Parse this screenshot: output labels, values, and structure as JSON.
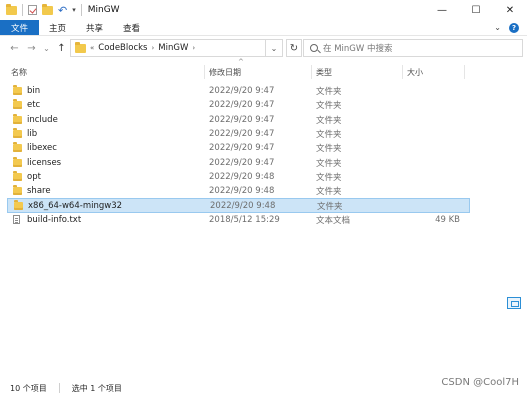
{
  "window": {
    "title": "MinGW",
    "controls": {
      "minimize": "—",
      "maximize": "☐",
      "close": "✕"
    }
  },
  "ribbon": {
    "tabs": [
      "文件",
      "主页",
      "共享",
      "查看"
    ],
    "expand": "⌄",
    "help": "?"
  },
  "nav": {
    "back": "←",
    "forward": "→",
    "recent": "⌄",
    "up": "↑"
  },
  "address": {
    "segments": [
      "CodeBlocks",
      "MinGW"
    ],
    "separator": "›",
    "lead_sep": "«",
    "dropdown": "⌄",
    "refresh": "↻"
  },
  "search": {
    "placeholder": "在 MinGW 中搜索"
  },
  "columns": {
    "name": "名称",
    "modified": "修改日期",
    "type": "类型",
    "size": "大小",
    "sort_indicator": "^"
  },
  "files": [
    {
      "name": "bin",
      "modified": "2022/9/20 9:47",
      "type": "文件夹",
      "size": "",
      "kind": "folder",
      "selected": false
    },
    {
      "name": "etc",
      "modified": "2022/9/20 9:47",
      "type": "文件夹",
      "size": "",
      "kind": "folder",
      "selected": false
    },
    {
      "name": "include",
      "modified": "2022/9/20 9:47",
      "type": "文件夹",
      "size": "",
      "kind": "folder",
      "selected": false
    },
    {
      "name": "lib",
      "modified": "2022/9/20 9:47",
      "type": "文件夹",
      "size": "",
      "kind": "folder",
      "selected": false
    },
    {
      "name": "libexec",
      "modified": "2022/9/20 9:47",
      "type": "文件夹",
      "size": "",
      "kind": "folder",
      "selected": false
    },
    {
      "name": "licenses",
      "modified": "2022/9/20 9:47",
      "type": "文件夹",
      "size": "",
      "kind": "folder",
      "selected": false
    },
    {
      "name": "opt",
      "modified": "2022/9/20 9:48",
      "type": "文件夹",
      "size": "",
      "kind": "folder",
      "selected": false
    },
    {
      "name": "share",
      "modified": "2022/9/20 9:48",
      "type": "文件夹",
      "size": "",
      "kind": "folder",
      "selected": false
    },
    {
      "name": "x86_64-w64-mingw32",
      "modified": "2022/9/20 9:48",
      "type": "文件夹",
      "size": "",
      "kind": "folder",
      "selected": true
    },
    {
      "name": "build-info.txt",
      "modified": "2018/5/12 15:29",
      "type": "文本文档",
      "size": "49 KB",
      "kind": "file",
      "selected": false
    }
  ],
  "status": {
    "item_count": "10 个项目",
    "selection": "选中 1 个项目"
  },
  "watermark": "CSDN @Cool7H",
  "colors": {
    "accent": "#1a6fc4",
    "selection_bg": "#cce4f7",
    "selection_border": "#99c9ef",
    "folder": "#f3c94f"
  }
}
